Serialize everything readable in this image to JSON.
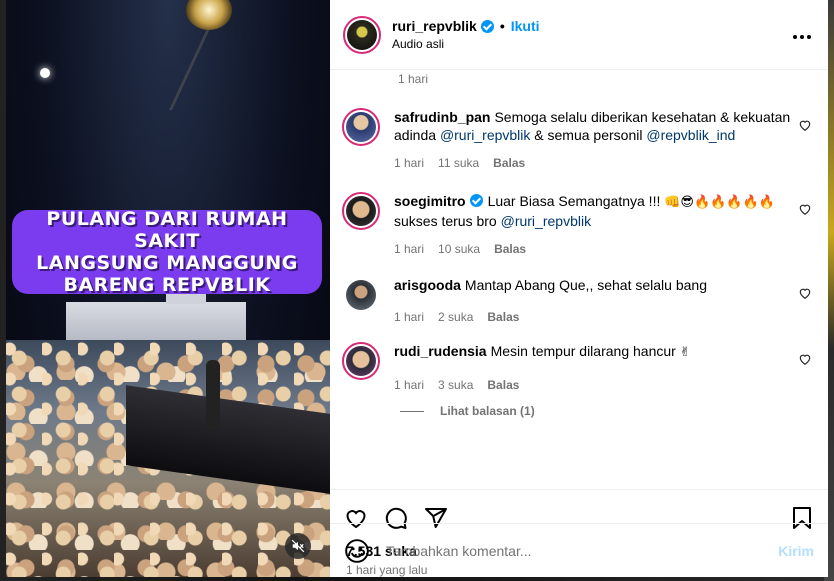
{
  "video": {
    "caption_overlay": "PULANG DARI RUMAH SAKIT\nLANGSUNG MANGGUNG\nBARENG REPVBLIK",
    "mute_icon": "muted-speaker-icon"
  },
  "header": {
    "username": "ruri_repvblik",
    "verified": true,
    "separator": "•",
    "follow_label": "Ikuti",
    "subtitle": "Audio asli",
    "more_icon": "more-options-icon",
    "more_label": "•••"
  },
  "comments": {
    "top_time": "1 hari",
    "items": [
      {
        "username": "safrudinb_pan",
        "verified": false,
        "text_parts": [
          "Semoga selalu diberikan kesehatan & kekuatan adinda ",
          "@ruri_repvblik",
          " & semua personil ",
          "@repvblik_ind"
        ],
        "time": "1 hari",
        "likes": "11 suka",
        "reply": "Balas"
      },
      {
        "username": "soegimitro",
        "verified": true,
        "text_parts": [
          "Luar Biasa Semangatnya !!! ",
          "👊😎🔥🔥🔥🔥🔥",
          " sukses terus bro ",
          "@ruri_repvblik"
        ],
        "time": "1 hari",
        "likes": "10 suka",
        "reply": "Balas"
      },
      {
        "username": "arisgooda",
        "verified": false,
        "text_parts": [
          "Mantap Abang Que,, sehat selalu bang"
        ],
        "time": "1 hari",
        "likes": "2 suka",
        "reply": "Balas"
      },
      {
        "username": "rudi_rudensia",
        "verified": false,
        "text_parts": [
          "Mesin tempur dilarang hancur ",
          "✌"
        ],
        "time": "1 hari",
        "likes": "3 suka",
        "reply": "Balas"
      }
    ],
    "view_replies": "Lihat balasan (1)"
  },
  "actions": {
    "like_icon": "heart-icon",
    "comment_icon": "comment-icon",
    "share_icon": "share-icon",
    "save_icon": "bookmark-icon"
  },
  "stats": {
    "likes": "7.531 suka",
    "time_ago": "1 hari yang lalu"
  },
  "add_comment": {
    "emoji_icon": "emoji-icon",
    "placeholder": "Tambahkan komentar...",
    "post_label": "Kirim"
  },
  "colors": {
    "accent": "#0095f6",
    "caption_bg": "#7b3cf0",
    "post_disabled": "#b2dffc",
    "mention": "#00376b"
  }
}
